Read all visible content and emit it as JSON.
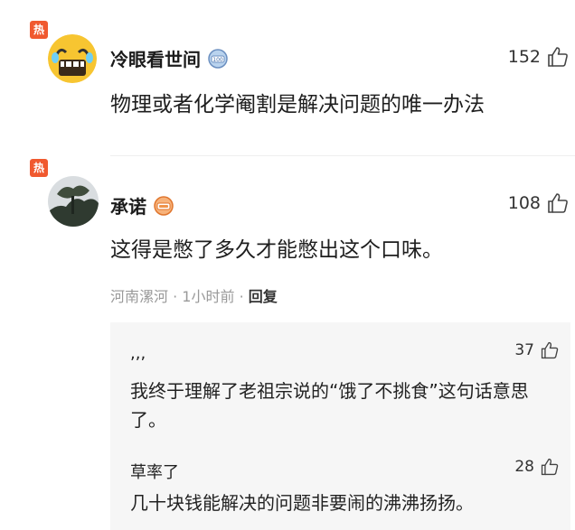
{
  "comments": [
    {
      "hot_label": "热",
      "username": "冷眼看世间",
      "badge_text": "100",
      "likes": "152",
      "text": "物理或者化学阉割是解决问题的唯一办法"
    },
    {
      "hot_label": "热",
      "username": "承诺",
      "likes": "108",
      "text": "这得是憋了多久才能憋出这个口味。",
      "meta": {
        "location": "河南漯河",
        "time": "1小时前",
        "reply_label": "回复"
      },
      "replies": [
        {
          "username": ",,,",
          "likes": "37",
          "text": "我终于理解了老祖宗说的“饿了不挑食”这句话意思了。"
        },
        {
          "username": "草率了",
          "likes": "28",
          "text": "几十块钱能解决的问题非要闹的沸沸扬扬。"
        }
      ]
    }
  ],
  "colors": {
    "hot": "#f0592f",
    "reply_bg": "#f6f6f6"
  }
}
